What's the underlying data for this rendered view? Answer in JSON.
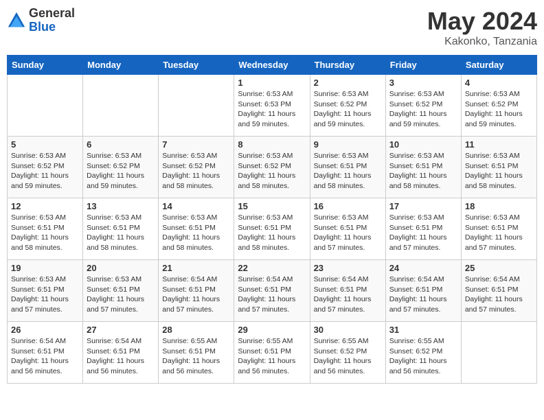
{
  "header": {
    "logo_general": "General",
    "logo_blue": "Blue",
    "month_year": "May 2024",
    "location": "Kakonko, Tanzania"
  },
  "days_of_week": [
    "Sunday",
    "Monday",
    "Tuesday",
    "Wednesday",
    "Thursday",
    "Friday",
    "Saturday"
  ],
  "weeks": [
    {
      "days": [
        {
          "num": "",
          "info": ""
        },
        {
          "num": "",
          "info": ""
        },
        {
          "num": "",
          "info": ""
        },
        {
          "num": "1",
          "info": "Sunrise: 6:53 AM\nSunset: 6:53 PM\nDaylight: 11 hours\nand 59 minutes."
        },
        {
          "num": "2",
          "info": "Sunrise: 6:53 AM\nSunset: 6:52 PM\nDaylight: 11 hours\nand 59 minutes."
        },
        {
          "num": "3",
          "info": "Sunrise: 6:53 AM\nSunset: 6:52 PM\nDaylight: 11 hours\nand 59 minutes."
        },
        {
          "num": "4",
          "info": "Sunrise: 6:53 AM\nSunset: 6:52 PM\nDaylight: 11 hours\nand 59 minutes."
        }
      ]
    },
    {
      "days": [
        {
          "num": "5",
          "info": "Sunrise: 6:53 AM\nSunset: 6:52 PM\nDaylight: 11 hours\nand 59 minutes."
        },
        {
          "num": "6",
          "info": "Sunrise: 6:53 AM\nSunset: 6:52 PM\nDaylight: 11 hours\nand 59 minutes."
        },
        {
          "num": "7",
          "info": "Sunrise: 6:53 AM\nSunset: 6:52 PM\nDaylight: 11 hours\nand 58 minutes."
        },
        {
          "num": "8",
          "info": "Sunrise: 6:53 AM\nSunset: 6:52 PM\nDaylight: 11 hours\nand 58 minutes."
        },
        {
          "num": "9",
          "info": "Sunrise: 6:53 AM\nSunset: 6:51 PM\nDaylight: 11 hours\nand 58 minutes."
        },
        {
          "num": "10",
          "info": "Sunrise: 6:53 AM\nSunset: 6:51 PM\nDaylight: 11 hours\nand 58 minutes."
        },
        {
          "num": "11",
          "info": "Sunrise: 6:53 AM\nSunset: 6:51 PM\nDaylight: 11 hours\nand 58 minutes."
        }
      ]
    },
    {
      "days": [
        {
          "num": "12",
          "info": "Sunrise: 6:53 AM\nSunset: 6:51 PM\nDaylight: 11 hours\nand 58 minutes."
        },
        {
          "num": "13",
          "info": "Sunrise: 6:53 AM\nSunset: 6:51 PM\nDaylight: 11 hours\nand 58 minutes."
        },
        {
          "num": "14",
          "info": "Sunrise: 6:53 AM\nSunset: 6:51 PM\nDaylight: 11 hours\nand 58 minutes."
        },
        {
          "num": "15",
          "info": "Sunrise: 6:53 AM\nSunset: 6:51 PM\nDaylight: 11 hours\nand 58 minutes."
        },
        {
          "num": "16",
          "info": "Sunrise: 6:53 AM\nSunset: 6:51 PM\nDaylight: 11 hours\nand 57 minutes."
        },
        {
          "num": "17",
          "info": "Sunrise: 6:53 AM\nSunset: 6:51 PM\nDaylight: 11 hours\nand 57 minutes."
        },
        {
          "num": "18",
          "info": "Sunrise: 6:53 AM\nSunset: 6:51 PM\nDaylight: 11 hours\nand 57 minutes."
        }
      ]
    },
    {
      "days": [
        {
          "num": "19",
          "info": "Sunrise: 6:53 AM\nSunset: 6:51 PM\nDaylight: 11 hours\nand 57 minutes."
        },
        {
          "num": "20",
          "info": "Sunrise: 6:53 AM\nSunset: 6:51 PM\nDaylight: 11 hours\nand 57 minutes."
        },
        {
          "num": "21",
          "info": "Sunrise: 6:54 AM\nSunset: 6:51 PM\nDaylight: 11 hours\nand 57 minutes."
        },
        {
          "num": "22",
          "info": "Sunrise: 6:54 AM\nSunset: 6:51 PM\nDaylight: 11 hours\nand 57 minutes."
        },
        {
          "num": "23",
          "info": "Sunrise: 6:54 AM\nSunset: 6:51 PM\nDaylight: 11 hours\nand 57 minutes."
        },
        {
          "num": "24",
          "info": "Sunrise: 6:54 AM\nSunset: 6:51 PM\nDaylight: 11 hours\nand 57 minutes."
        },
        {
          "num": "25",
          "info": "Sunrise: 6:54 AM\nSunset: 6:51 PM\nDaylight: 11 hours\nand 57 minutes."
        }
      ]
    },
    {
      "days": [
        {
          "num": "26",
          "info": "Sunrise: 6:54 AM\nSunset: 6:51 PM\nDaylight: 11 hours\nand 56 minutes."
        },
        {
          "num": "27",
          "info": "Sunrise: 6:54 AM\nSunset: 6:51 PM\nDaylight: 11 hours\nand 56 minutes."
        },
        {
          "num": "28",
          "info": "Sunrise: 6:55 AM\nSunset: 6:51 PM\nDaylight: 11 hours\nand 56 minutes."
        },
        {
          "num": "29",
          "info": "Sunrise: 6:55 AM\nSunset: 6:51 PM\nDaylight: 11 hours\nand 56 minutes."
        },
        {
          "num": "30",
          "info": "Sunrise: 6:55 AM\nSunset: 6:52 PM\nDaylight: 11 hours\nand 56 minutes."
        },
        {
          "num": "31",
          "info": "Sunrise: 6:55 AM\nSunset: 6:52 PM\nDaylight: 11 hours\nand 56 minutes."
        },
        {
          "num": "",
          "info": ""
        }
      ]
    }
  ]
}
